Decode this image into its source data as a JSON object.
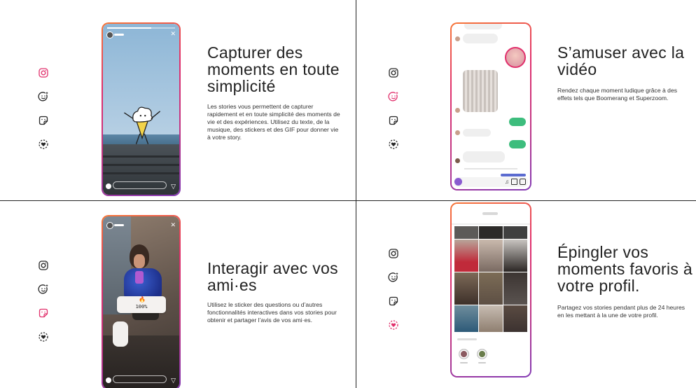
{
  "sections": [
    {
      "title": "Capturer des moments en toute simplicité",
      "description": "Les stories vous permettent de capturer rapidement et en toute simplicité des moments de vie et des expériences. Utilisez du texte, de la musique, des stickers et des GIF pour donner vie à votre story.",
      "active_icon": "camera-icon"
    },
    {
      "title": "S’amuser avec la vidéo",
      "description": "Rendez chaque moment ludique grâce à des effets tels que Boomerang et Superzoom.",
      "active_icon": "smiley-sparkle-icon"
    },
    {
      "title": "Interagir avec vos ami·es",
      "description": "Utilisez le sticker des questions ou d’autres fonctionnalités interactives dans vos stories pour obtenir et partager l’avis de vos ami·es.",
      "active_icon": "sticker-icon",
      "poll_value": "100",
      "poll_unit": "%"
    },
    {
      "title": "Épingler vos moments favoris à votre profil.",
      "description": "Partagez vos stories pendant plus de 24 heures en les mettant à la une de votre profil.",
      "active_icon": "heart-highlight-icon"
    }
  ],
  "icons": [
    "camera-icon",
    "smiley-sparkle-icon",
    "sticker-icon",
    "heart-highlight-icon"
  ],
  "colors": {
    "accent": "#e1306c",
    "text": "#222222",
    "icon_inactive": "#262626",
    "green_bubble": "#3dbd7d"
  }
}
